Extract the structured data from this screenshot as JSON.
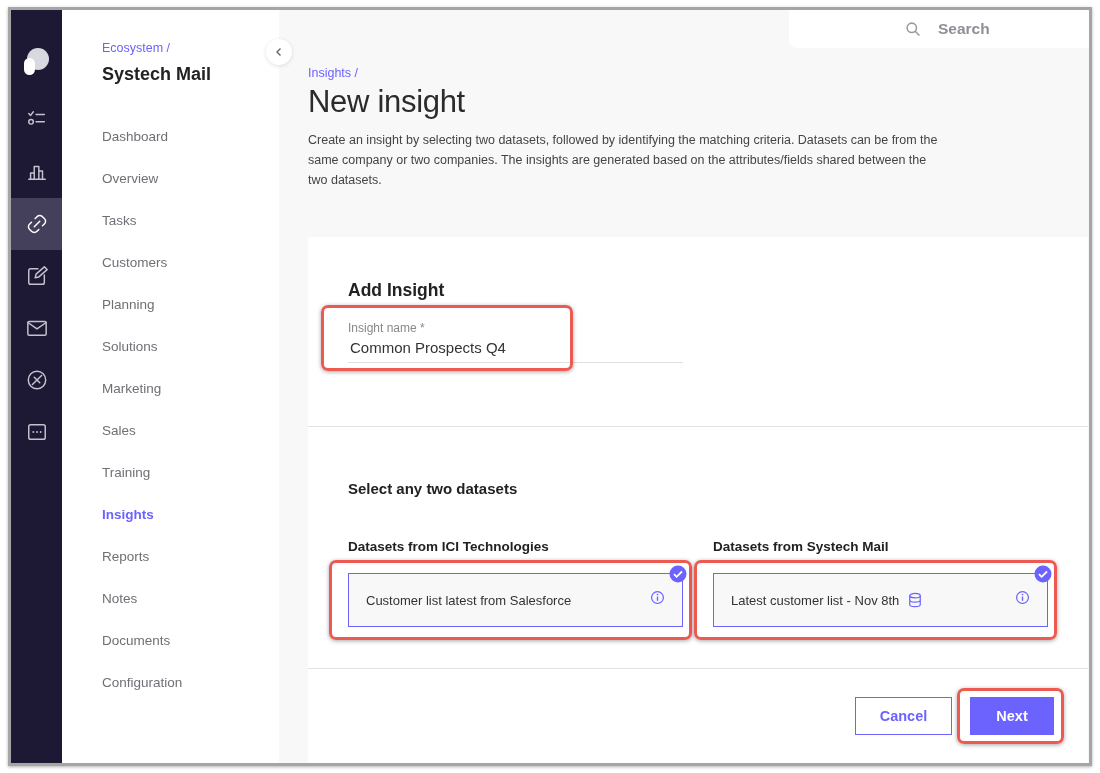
{
  "rail": {
    "items": [
      {
        "kind": "checklist",
        "selected": false
      },
      {
        "kind": "chart",
        "selected": false
      },
      {
        "kind": "link",
        "selected": true
      },
      {
        "kind": "edit",
        "selected": false
      },
      {
        "kind": "mail",
        "selected": false
      },
      {
        "kind": "cancel",
        "selected": false
      },
      {
        "kind": "more",
        "selected": false
      }
    ]
  },
  "sidebar": {
    "breadcrumb": "Ecosystem /",
    "title": "Systech Mail",
    "items": [
      {
        "label": "Dashboard",
        "selected": false
      },
      {
        "label": "Overview",
        "selected": false
      },
      {
        "label": "Tasks",
        "selected": false
      },
      {
        "label": "Customers",
        "selected": false
      },
      {
        "label": "Planning",
        "selected": false
      },
      {
        "label": "Solutions",
        "selected": false
      },
      {
        "label": "Marketing",
        "selected": false
      },
      {
        "label": "Sales",
        "selected": false
      },
      {
        "label": "Training",
        "selected": false
      },
      {
        "label": "Insights",
        "selected": true
      },
      {
        "label": "Reports",
        "selected": false
      },
      {
        "label": "Notes",
        "selected": false
      },
      {
        "label": "Documents",
        "selected": false
      },
      {
        "label": "Configuration",
        "selected": false
      }
    ]
  },
  "search": {
    "placeholder": "Search"
  },
  "page": {
    "breadcrumb": "Insights /",
    "title": "New insight",
    "description": "Create an insight by selecting two datasets, followed by identifying the matching criteria. Datasets can be from the same company or two companies. The insights are generated based on the attributes/fields shared between the two datasets."
  },
  "form": {
    "heading": "Add Insight",
    "name_field": {
      "label": "Insight name *",
      "value": "Common Prospects Q4",
      "highlighted": true
    },
    "datasets_heading": "Select any two datasets",
    "dataset_groups": [
      {
        "heading": "Datasets from ICI Technologies",
        "dataset": {
          "name": "Customer list latest from Salesforce",
          "selected": true,
          "database_icon": false,
          "highlighted": true
        }
      },
      {
        "heading": "Datasets from Systech Mail",
        "dataset": {
          "name": "Latest customer list - Nov 8th",
          "selected": true,
          "database_icon": true,
          "highlighted": true
        }
      }
    ],
    "buttons": [
      {
        "label": "Cancel",
        "kind": "secondary",
        "highlighted": false
      },
      {
        "label": "Next",
        "kind": "primary",
        "highlighted": true
      }
    ]
  }
}
